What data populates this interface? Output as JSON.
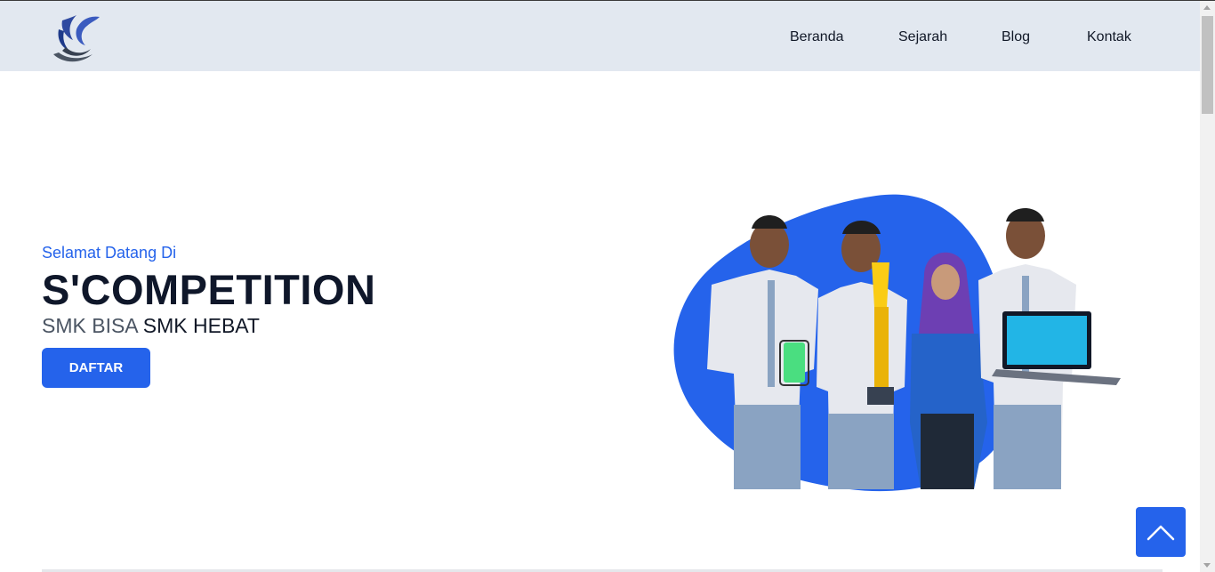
{
  "nav": {
    "logo_icon": "school-emblem-logo",
    "items": [
      {
        "label": "Beranda"
      },
      {
        "label": "Sejarah"
      },
      {
        "label": "Blog"
      },
      {
        "label": "Kontak"
      }
    ]
  },
  "hero": {
    "welcome": "Selamat Datang Di",
    "title": "S'COMPETITION",
    "subtitle_part1": "SMK BISA",
    "subtitle_part2": "SMK HEBAT",
    "cta_label": "DAFTAR",
    "image": "students-with-trophy-photo"
  },
  "scroll_top_icon": "chevron-up-icon",
  "colors": {
    "accent": "#2563eb",
    "navbar_bg": "#e2e8f0",
    "title": "#0f172a"
  }
}
